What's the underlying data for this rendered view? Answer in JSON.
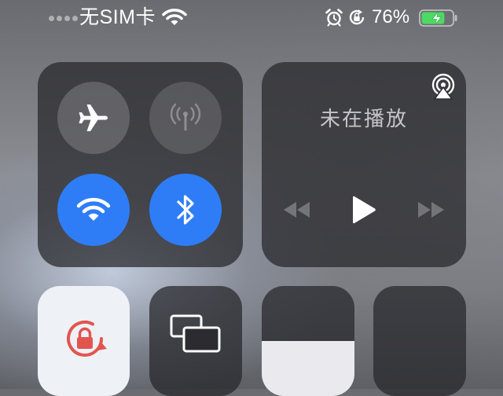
{
  "status_bar": {
    "carrier": "无SIM卡",
    "battery_percent": "76%",
    "battery_level": 0.76,
    "battery_charging": true,
    "icons": [
      "wifi-icon",
      "alarm-clock-icon",
      "orientation-lock-icon",
      "battery-icon",
      "charging-bolt-icon"
    ]
  },
  "connectivity": {
    "airplane_mode": {
      "icon": "airplane-icon",
      "on": false
    },
    "cellular_data": {
      "icon": "cellular-antenna-icon",
      "on": false,
      "enabled": false
    },
    "wifi": {
      "icon": "wifi-icon",
      "on": true
    },
    "bluetooth": {
      "icon": "bluetooth-icon",
      "on": true
    }
  },
  "media": {
    "now_playing": "未在播放",
    "icons": [
      "airplay-icon",
      "rewind-icon",
      "play-icon",
      "fast-forward-icon"
    ]
  },
  "controls": {
    "orientation_lock": {
      "icon": "orientation-lock-icon",
      "on": true
    },
    "screen_mirroring": {
      "icon": "screen-mirroring-icon"
    },
    "brightness_level": 0.4,
    "volume_level": 0
  },
  "colors": {
    "accent_blue": "#2f7df6",
    "lock_red": "#e2554f",
    "battery_green": "#4cd964"
  }
}
